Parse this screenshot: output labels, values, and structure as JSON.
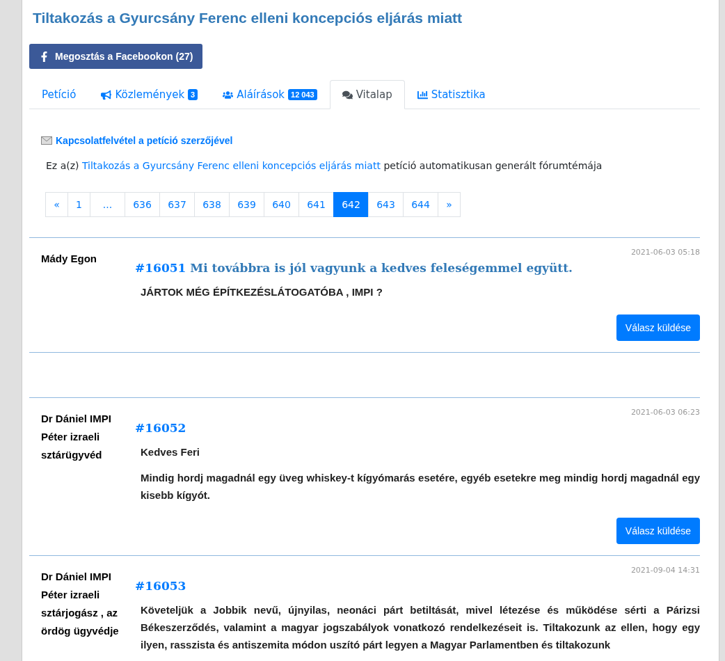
{
  "title": "Tiltakozás a Gyurcsány Ferenc elleni koncepciós eljárás miatt",
  "share_button": "Megosztás a Facebookon (27)",
  "tabs": [
    {
      "label": "Petíció",
      "kind": "plain",
      "selected": false
    },
    {
      "label": "Közlemények",
      "kind": "announcements",
      "badge": "3",
      "selected": false
    },
    {
      "label": "Aláírások",
      "kind": "signatures",
      "badge": "12 043",
      "selected": false
    },
    {
      "label": "Vitalap",
      "kind": "discussion",
      "selected": true
    },
    {
      "label": "Statisztika",
      "kind": "statistics",
      "selected": false
    }
  ],
  "contact_link": "Kapcsolatfelvétel a petíció szerzőjével",
  "intro": {
    "before": "Ez a(z)",
    "link": "Tiltakozás a Gyurcsány Ferenc elleni koncepciós eljárás miatt",
    "after": "petíció automatikusan generált fórumtémája"
  },
  "pagination": [
    {
      "label": "«",
      "selected": false
    },
    {
      "label": "1",
      "selected": false
    },
    {
      "label": "...",
      "selected": false
    },
    {
      "label": "636",
      "selected": false
    },
    {
      "label": "637",
      "selected": false
    },
    {
      "label": "638",
      "selected": false
    },
    {
      "label": "639",
      "selected": false
    },
    {
      "label": "640",
      "selected": false
    },
    {
      "label": "641",
      "selected": false
    },
    {
      "label": "642",
      "selected": true
    },
    {
      "label": "643",
      "selected": false
    },
    {
      "label": "644",
      "selected": false
    },
    {
      "label": "»",
      "selected": false
    }
  ],
  "posts": [
    {
      "author": "Mády Egon",
      "date": "2021-06-03 05:18",
      "number": "#16051",
      "subject": "Mi továbbra is jól vagyunk a kedves feleségemmel együtt.",
      "paragraphs": [
        "JÁRTOK MÉG ÉPÍTKEZÉSLÁTOGATÓBA , IMPI  ?"
      ],
      "reply_button": "Válasz küldése"
    },
    {
      "author": "Dr Dániel IMPI Péter izraeli sztárügyvéd",
      "date": "2021-06-03 06:23",
      "number": "#16052",
      "paragraphs": [
        "Kedves Feri",
        "Mindig hordj magadnál egy üveg whiskey-t kígyómarás esetére, egyéb esetekre meg mindig hordj magadnál egy kisebb kígyót."
      ],
      "reply_button": "Válasz küldése"
    },
    {
      "author": "Dr Dániel IMPI Péter izraeli sztárjogász , az ördög ügyvédje",
      "date": "2021-09-04 14:31",
      "number": "#16053",
      "paragraphs": [
        "Követeljük a Jobbik nevű, újnyilas, neonáci párt betiltását, mivel létezése és működése sérti a Párizsi Békeszerződés, valamint a magyar jogszabályok vonatkozó rendelkezéseit is. Tiltakozunk az ellen, hogy egy ilyen, rasszista és antiszemita módon uszító párt legyen a Magyar Parlamentben és tiltakozunk"
      ]
    }
  ]
}
